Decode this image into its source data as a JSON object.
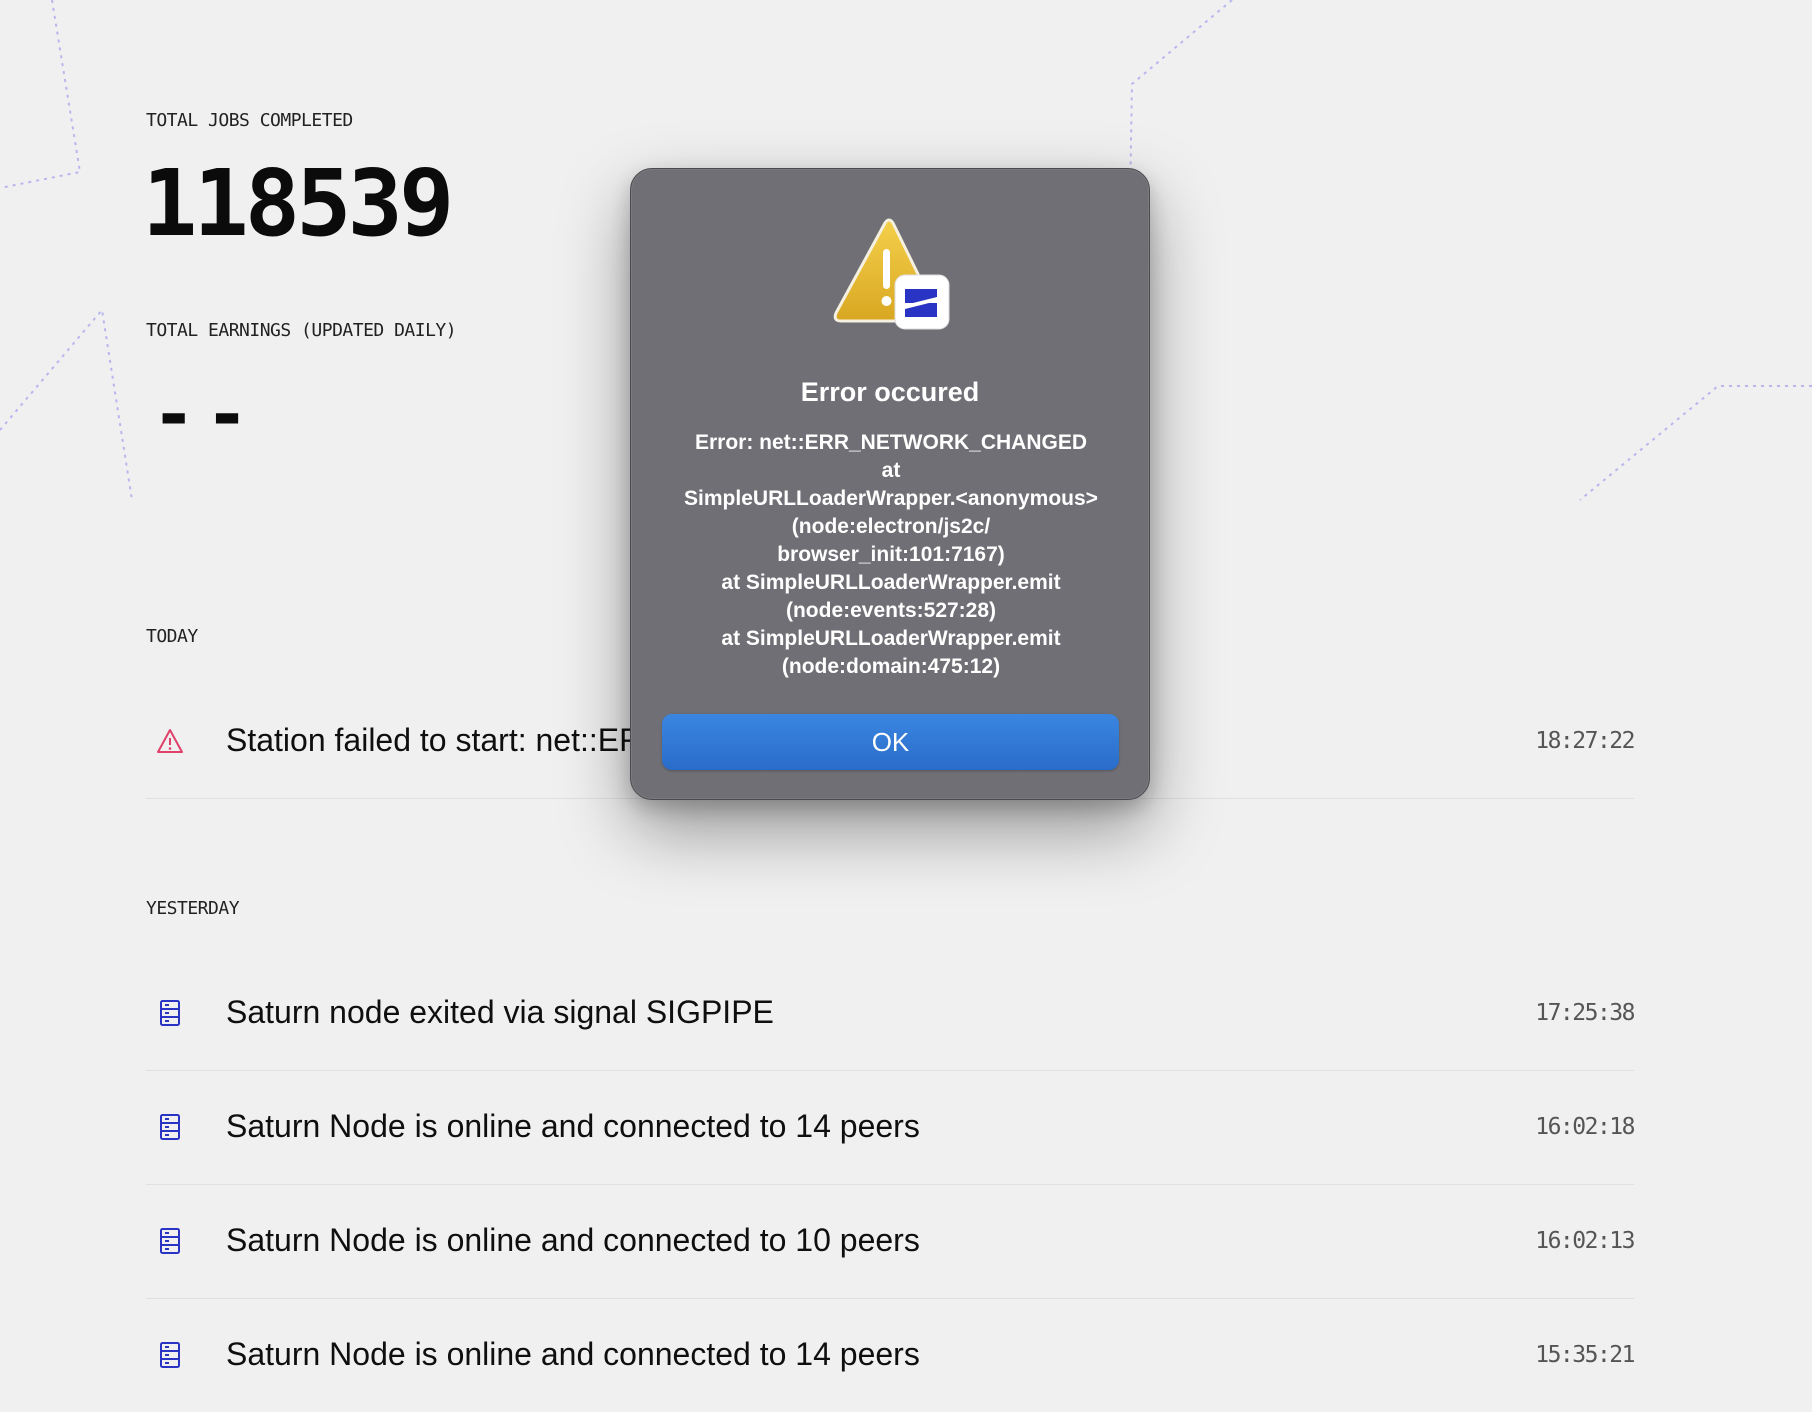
{
  "stats": {
    "jobs_label": "TOTAL JOBS COMPLETED",
    "jobs_value": "118539",
    "earnings_label": "TOTAL EARNINGS (UPDATED DAILY)",
    "earnings_value": "--"
  },
  "activity": {
    "today_label": "TODAY",
    "yesterday_label": "YESTERDAY",
    "today": [
      {
        "icon": "warning-icon",
        "text": "Station failed to start: net::ERR_NETWORK_CHANGED",
        "time": "18:27:22",
        "color": "#e0406a"
      }
    ],
    "yesterday": [
      {
        "icon": "server-icon",
        "text": "Saturn node exited via signal SIGPIPE",
        "time": "17:25:38",
        "color": "#2a34c4"
      },
      {
        "icon": "server-icon",
        "text": "Saturn Node is online and connected to 14 peers",
        "time": "16:02:18",
        "color": "#2a34c4"
      },
      {
        "icon": "server-icon",
        "text": "Saturn Node is online and connected to 10 peers",
        "time": "16:02:13",
        "color": "#2a34c4"
      },
      {
        "icon": "server-icon",
        "text": "Saturn Node is online and connected to 14 peers",
        "time": "15:35:21",
        "color": "#2a34c4"
      }
    ]
  },
  "dialog": {
    "icon": "warning-app-icon",
    "title": "Error occured",
    "message_lines": [
      "Error: net::ERR_NETWORK_CHANGED",
      "at",
      "SimpleURLLoaderWrapper.<anonymous>",
      "(node:electron/js2c/",
      "browser_init:101:7167)",
      "at SimpleURLLoaderWrapper.emit",
      "(node:events:527:28)",
      "at SimpleURLLoaderWrapper.emit",
      "(node:domain:475:12)"
    ],
    "ok_label": "OK",
    "button_color": "#2f78d8"
  }
}
